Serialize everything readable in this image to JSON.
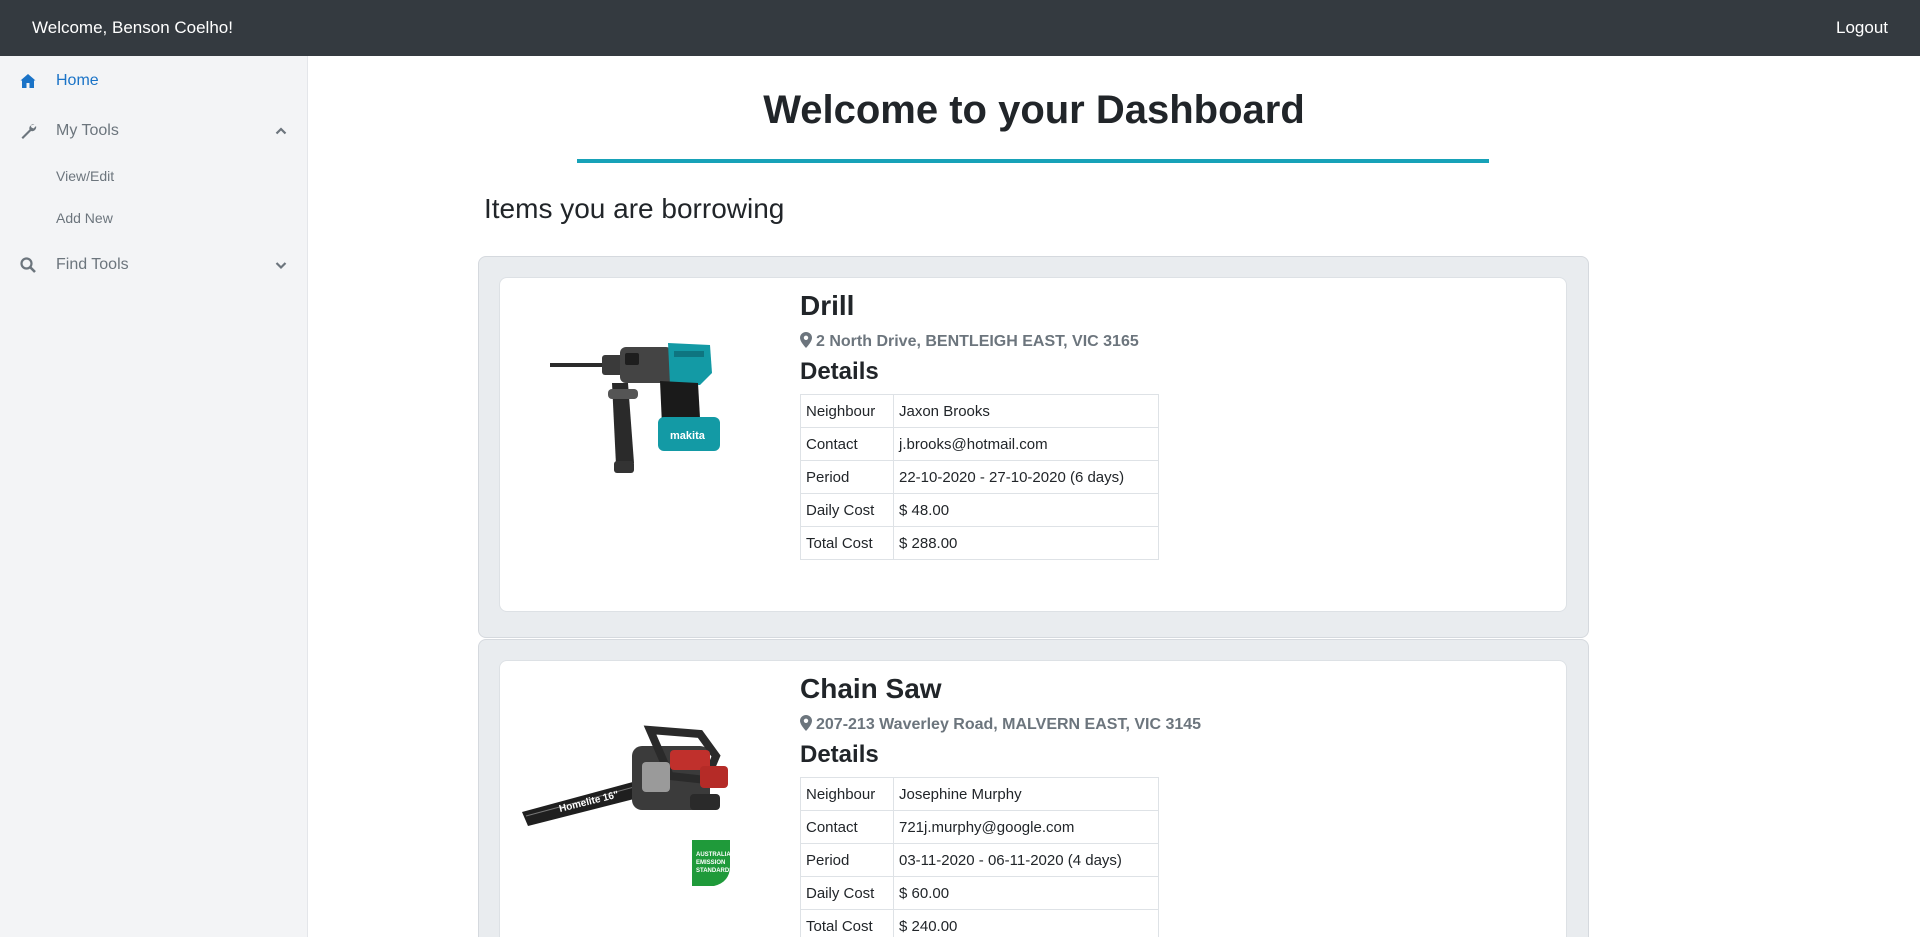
{
  "topbar": {
    "welcome": "Welcome, Benson Coelho!",
    "logout": "Logout"
  },
  "sidebar": {
    "home": {
      "label": "Home",
      "icon": "home-icon"
    },
    "my_tools": {
      "label": "My Tools",
      "icon": "wrench-icon",
      "expanded": true,
      "items": [
        {
          "label": "View/Edit"
        },
        {
          "label": "Add New"
        }
      ]
    },
    "find_tools": {
      "label": "Find Tools",
      "icon": "search-icon",
      "expanded": false
    }
  },
  "main": {
    "title": "Welcome to your Dashboard",
    "section_title": "Items you are borrowing",
    "details_heading": "Details",
    "borrowed": [
      {
        "name": "Drill",
        "address": "2 North Drive, BENTLEIGH EAST, VIC 3165",
        "details": [
          {
            "key": "Neighbour",
            "value": "Jaxon Brooks"
          },
          {
            "key": "Contact",
            "value": "j.brooks@hotmail.com"
          },
          {
            "key": "Period",
            "value": "22-10-2020 - 27-10-2020 (6 days)"
          },
          {
            "key": "Daily Cost",
            "value": "$ 48.00"
          },
          {
            "key": "Total Cost",
            "value": "$ 288.00"
          }
        ]
      },
      {
        "name": "Chain Saw",
        "address": "207-213 Waverley Road, MALVERN EAST, VIC 3145",
        "details": [
          {
            "key": "Neighbour",
            "value": "Josephine Murphy"
          },
          {
            "key": "Contact",
            "value": "721j.murphy@google.com"
          },
          {
            "key": "Period",
            "value": "03-11-2020 - 06-11-2020 (4 days)"
          },
          {
            "key": "Daily Cost",
            "value": "$ 60.00"
          },
          {
            "key": "Total Cost",
            "value": "$ 240.00"
          }
        ]
      }
    ]
  },
  "colors": {
    "navbar": "#343a40",
    "sidebar_bg": "#f3f4f6",
    "active_link": "#1a73c7",
    "accent_rule": "#17a2b8",
    "card_outer": "#e9ecef"
  }
}
